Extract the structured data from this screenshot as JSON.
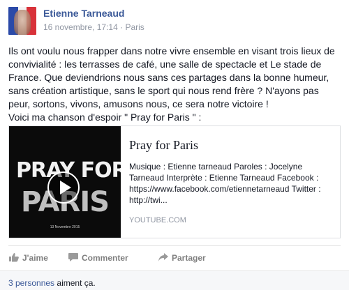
{
  "post": {
    "author": "Etienne Tarneaud",
    "date": "16 novembre, 17:14",
    "separator": "·",
    "location": "Paris",
    "text_lines": [
      "Ils ont voulu nous frapper dans notre vivre ensemble en visant trois lieux de",
      "convivialité : les terrasses de café, une salle de spectacle et Le stade de",
      "France. Que deviendrions nous sans ces partages dans la bonne humeur,",
      "sans création artistique, sans le sport qui nous rend frère ? N'ayons pas",
      "peur, sortons, vivons, amusons nous, ce sera notre victoire !",
      "Voici ma chanson d'espoir \" Pray for Paris \" :"
    ]
  },
  "attachment": {
    "thumbnail": {
      "line1": "PRAY FOR",
      "line2": "PARIS",
      "date": "13 Novembre 2015"
    },
    "title": "Pray for Paris",
    "description_lines": [
      "Musique : Etienne tarneaud Paroles : Jocelyne",
      "Tarneaud Interprète : Etienne Tarneaud Facebook :",
      "https://www.facebook.com/etiennetarneaud Twitter :",
      "http://twi..."
    ],
    "source": "YOUTUBE.COM"
  },
  "actions": {
    "like": "J'aime",
    "comment": "Commenter",
    "share": "Partager"
  },
  "likes": {
    "link": "3 personnes",
    "rest": "aiment ça."
  },
  "colors": {
    "link": "#3b5998",
    "meta": "#9197a3",
    "action": "#7f7f7f"
  },
  "icons": {
    "like": "thumbs-up-icon",
    "comment": "speech-bubble-icon",
    "share": "share-arrow-icon",
    "play": "play-icon"
  }
}
